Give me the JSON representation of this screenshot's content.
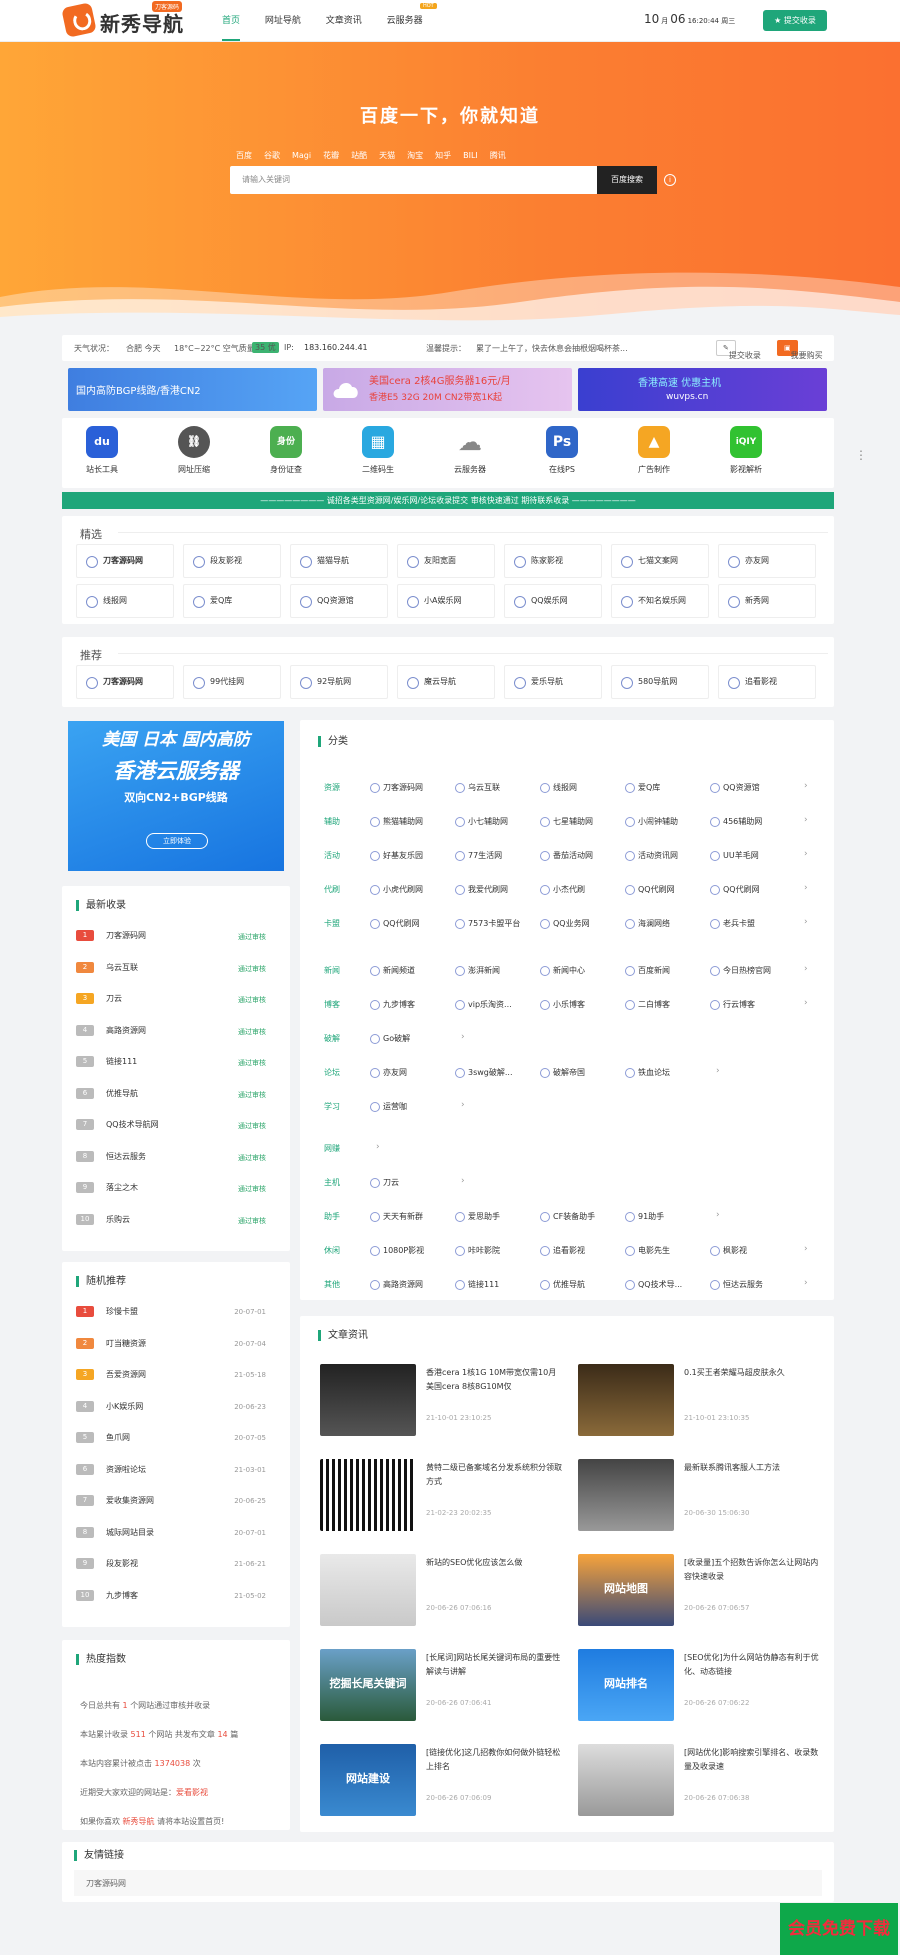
{
  "nav": {
    "logo_text": "新秀导航",
    "logo_tag": "刀客源码",
    "menu": [
      {
        "label": "首页",
        "active": true
      },
      {
        "label": "网址导航"
      },
      {
        "label": "文章资讯"
      },
      {
        "label": "云服务器",
        "badge": "HOT"
      }
    ],
    "date": {
      "month": "10",
      "month_unit": "月",
      "day": "06",
      "time": "16:20:44 周三"
    },
    "submit_label": "提交收录"
  },
  "hero": {
    "title": "百度一下，你就知道",
    "engines": [
      "百度",
      "谷歌",
      "Magi",
      "花瓣",
      "站酷",
      "天猫",
      "淘宝",
      "知乎",
      "BILI",
      "腾讯"
    ],
    "search_placeholder": "请输入关键词",
    "search_button": "百度搜索"
  },
  "infobar": {
    "weather_label": "天气状况：",
    "weather": "合肥 今天",
    "temperature": "18°C~22°C 空气质量:",
    "aqi": "35 优",
    "ip_label": "IP:",
    "ip": "183.160.244.41",
    "tip_label": "温馨提示：",
    "tip": "累了一上午了，快去休息会抽根烟喝杯茶...",
    "btn_submit": "提交收录",
    "btn_ad": "我要购买"
  },
  "banners": [
    {
      "line1": "国内高防BGP线路/香港CN2",
      "line2": ""
    },
    {
      "line1": "美国cera 2核4G服务器16元/月",
      "line2": "香港E5 32G 20M CN2带宽1K起"
    },
    {
      "line1": "香港高速 优惠主机",
      "line2": "wuvps.cn"
    }
  ],
  "tools": [
    {
      "label": "站长工具",
      "glyph": "du",
      "color": "#2a60d8"
    },
    {
      "label": "网址压缩",
      "glyph": "⛓",
      "color": "#555555"
    },
    {
      "label": "身份证查",
      "glyph": "身份",
      "color": "#4caf50"
    },
    {
      "label": "二维码生",
      "glyph": "▦",
      "color": "#29a8e0"
    },
    {
      "label": "云服务器",
      "glyph": "☁",
      "color": "#9e9e9e"
    },
    {
      "label": "在线PS",
      "glyph": "Ps",
      "color": "#2f66c8"
    },
    {
      "label": "广告制作",
      "glyph": "▲",
      "color": "#f5a623"
    },
    {
      "label": "影视解析",
      "glyph": "iQIY",
      "color": "#31c231"
    }
  ],
  "notice": "———————— 诚招各类型资源网/娱乐网/论坛收录提交 审核快速通过 期待联系收录 ————————",
  "featured": {
    "title": "精选",
    "items": [
      "刀客源码网",
      "段友影视",
      "猫猫导航",
      "友阳宽面",
      "陈家影视",
      "七猫文案网",
      "亦友网",
      "线报网",
      "爱Q库",
      "QQ资源馆",
      "小A娱乐网",
      "QQ娱乐网",
      "不知名娱乐网",
      "新秀网"
    ]
  },
  "recommend": {
    "title": "推荐",
    "items": [
      "刀客源码网",
      "99代挂网",
      "92导航网",
      "魔云导航",
      "爱乐导航",
      "580导航网",
      "追看影视"
    ]
  },
  "side_ad": {
    "line1": "美国 日本 国内高防",
    "line2": "香港云服务器",
    "line3": "双向CN2+BGP线路",
    "button": "立即体验"
  },
  "latest": {
    "title": "最新收录",
    "status": "通过审核",
    "items": [
      "刀客源码网",
      "乌云互联",
      "刀云",
      "高路资源网",
      "链接111",
      "优推导航",
      "QQ技术导航网",
      "恒达云服务",
      "落尘之木",
      "乐购云"
    ]
  },
  "random": {
    "title": "随机推荐",
    "items": [
      {
        "name": "珍慢卡盟",
        "date": "20-07-01"
      },
      {
        "name": "叮当糖资源",
        "date": "20-07-04"
      },
      {
        "name": "吾爱资源网",
        "date": "21-05-18"
      },
      {
        "name": "小K娱乐网",
        "date": "20-06-23"
      },
      {
        "name": "鱼爪网",
        "date": "20-07-05"
      },
      {
        "name": "资源啦论坛",
        "date": "21-03-01"
      },
      {
        "name": "爱收集资源网",
        "date": "20-06-25"
      },
      {
        "name": "城际网站目录",
        "date": "20-07-01"
      },
      {
        "name": "段友影视",
        "date": "21-06-21"
      },
      {
        "name": "九步博客",
        "date": "21-05-02"
      }
    ]
  },
  "stats": {
    "title": "热度指数",
    "l1a": "今日总共有",
    "l1v": "1",
    "l1b": "个网站通过审核并收录",
    "l2a": "本站累计收录",
    "l2v": "511",
    "l2b": "个网站 共发布文章",
    "l2v2": "14",
    "l2c": "篇",
    "l3a": "本站内容累计被点击",
    "l3v": "1374038",
    "l3b": "次",
    "l4a": "近期受大家欢迎的网站是：",
    "l4v": "爱看影视",
    "l5a": "如果你喜欢",
    "l5v": "新秀导航",
    "l5b": "请将本站设置首页!"
  },
  "categories": {
    "title": "分类",
    "rows": [
      {
        "name": "资源",
        "links": [
          "刀客源码网",
          "乌云互联",
          "线报网",
          "爱Q库",
          "QQ资源馆"
        ]
      },
      {
        "name": "辅助",
        "links": [
          "熊猫辅助网",
          "小七辅助网",
          "七星辅助网",
          "小闹钟辅助",
          "456辅助网"
        ]
      },
      {
        "name": "活动",
        "links": [
          "好基友乐园",
          "77生活网",
          "番茄活动网",
          "活动资讯网",
          "UU羊毛网"
        ]
      },
      {
        "name": "代刷",
        "links": [
          "小虎代刷网",
          "我爱代刷网",
          "小杰代刷",
          "QQ代刷网",
          "QQ代刷网"
        ]
      },
      {
        "name": "卡盟",
        "links": [
          "QQ代刷网",
          "7573卡盟平台",
          "QQ业务网",
          "海澜网络",
          "老兵卡盟"
        ]
      },
      {
        "name": "新闻",
        "links": [
          "新闻频道",
          "澎湃新闻",
          "新闻中心",
          "百度新闻",
          "今日热榜官网"
        ]
      },
      {
        "name": "博客",
        "links": [
          "九步博客",
          "vip乐淘资...",
          "小乐博客",
          "二白博客",
          "行云博客"
        ]
      },
      {
        "name": "破解",
        "links": [
          "Go破解"
        ]
      },
      {
        "name": "论坛",
        "links": [
          "亦友网",
          "3swg破解...",
          "破解帝国",
          "铁血论坛"
        ]
      },
      {
        "name": "学习",
        "links": [
          "运营咖"
        ]
      },
      {
        "name": "网赚",
        "links": []
      },
      {
        "name": "主机",
        "links": [
          "刀云"
        ]
      },
      {
        "name": "助手",
        "links": [
          "天天有新群",
          "爱思助手",
          "CF装备助手",
          "91助手"
        ]
      },
      {
        "name": "休闲",
        "links": [
          "1080P影视",
          "咔咔影院",
          "追看影视",
          "电影先生",
          "枫影视"
        ]
      },
      {
        "name": "其他",
        "links": [
          "高路资源网",
          "链接111",
          "优推导航",
          "QQ技术导...",
          "恒达云服务"
        ]
      }
    ]
  },
  "articles": {
    "title": "文章资讯",
    "items": [
      {
        "title": "香港cera 1核1G 10M带宽仅需10月 美国cera 8核8G10M仅",
        "date": "21-10-01 23:10:25"
      },
      {
        "title": "0.1买王者荣耀马超皮肤永久",
        "date": "21-10-01 23:10:35"
      },
      {
        "title": "黄特二级已备案域名分发系统积分领取方式",
        "date": "21-02-23 20:02:35"
      },
      {
        "title": "最新联系腾讯客服人工方法",
        "date": "20-06-30 15:06:30"
      },
      {
        "title": "新站的SEO优化应该怎么做",
        "date": "20-06-26 07:06:16"
      },
      {
        "title": "[收录量]五个招数告诉你怎么让网站内容快速收录",
        "date": "20-06-26 07:06:57"
      },
      {
        "title": "[长尾词]网站长尾关键词布局的重要性解读与讲解",
        "date": "20-06-26 07:06:41"
      },
      {
        "title": "[SEO优化]为什么网站伪静态有利于优化、动态链接",
        "date": "20-06-26 07:06:22"
      },
      {
        "title": "[链接优化]这几招教你如何做外链轻松上排名",
        "date": "20-06-26 07:06:09"
      },
      {
        "title": "[网站优化]影响搜索引擎排名、收录数量及收录速",
        "date": "20-06-26 07:06:38"
      }
    ],
    "thumb_texts": [
      "",
      "",
      "",
      "",
      "",
      "网站地图",
      "挖掘长尾关键词",
      "网站排名",
      "网站建设",
      ""
    ]
  },
  "friend_links": {
    "title": "友情链接",
    "items": [
      "刀客源码网"
    ]
  },
  "vip_label": "会员免费下载",
  "colors": {
    "accent": "#1fa67a",
    "orange": "#fb7f31"
  }
}
